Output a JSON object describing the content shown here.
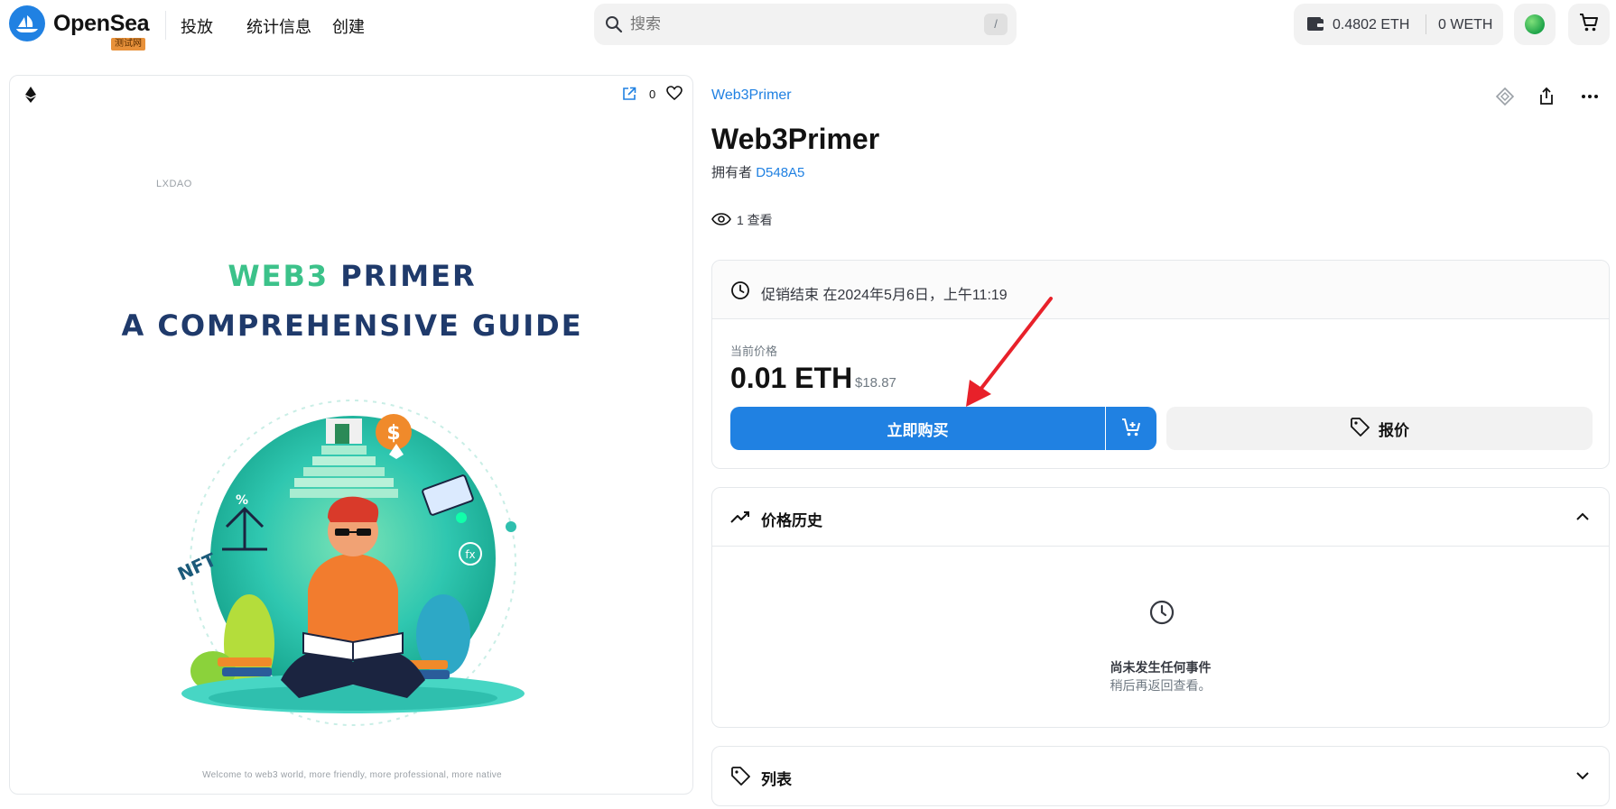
{
  "nav": {
    "brand": "OpenSea",
    "badge": "测试网",
    "links": [
      "投放",
      "统计信息",
      "创建"
    ],
    "search_placeholder": "搜索",
    "search_shortcut": "/",
    "balance_eth": "0.4802 ETH",
    "balance_weth": "0 WETH",
    "icons": [
      "opensea-logo",
      "search-icon",
      "wallet-icon",
      "avatar",
      "cart-icon"
    ]
  },
  "media": {
    "favorites_count": "0",
    "icons": [
      "ethereum-icon",
      "external-link-icon",
      "heart-icon"
    ],
    "artwork": {
      "brand": "LXDAO",
      "title_line1_accent": "WEB3",
      "title_line1_rest": " PRIMER",
      "title_line2": "A COMPREHENSIVE GUIDE",
      "footer": "Welcome to web3 world, more friendly, more professional, more native"
    }
  },
  "item": {
    "collection": "Web3Primer",
    "title": "Web3Primer",
    "owner_label": "拥有者",
    "owner_value": "D548A5",
    "views": "1 查看",
    "top_icons": [
      "transfer-icon",
      "share-icon",
      "more-icon"
    ]
  },
  "sale": {
    "end_text": "促销结束 在2024年5月6日，上午11:19",
    "current_price_label": "当前价格",
    "price": "0.01 ETH",
    "price_usd": "$18.87",
    "buy_label": "立即购买",
    "offer_label": "报价"
  },
  "price_history": {
    "title": "价格历史",
    "empty_title": "尚未发生任何事件",
    "empty_sub": "稍后再返回查看。"
  },
  "listings": {
    "title": "列表"
  },
  "colors": {
    "accent": "#2081e2",
    "annotation_arrow": "#e8212a"
  }
}
